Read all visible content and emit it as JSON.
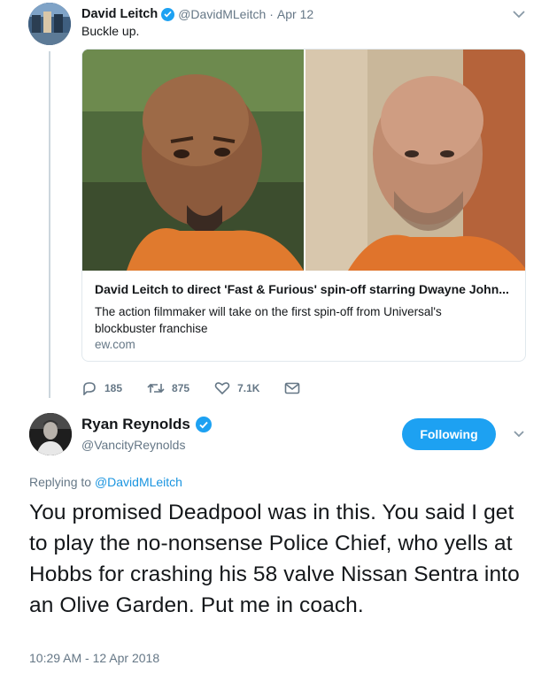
{
  "quoted_tweet": {
    "author_name": "David Leitch",
    "handle": "@DavidMLeitch",
    "date": "Apr 12",
    "text": "Buckle up.",
    "card": {
      "title": "David Leitch to direct 'Fast & Furious' spin-off starring Dwayne John...",
      "description": "The action filmmaker will take on the first spin-off from Universal's blockbuster franchise",
      "domain": "ew.com"
    },
    "actions": {
      "replies": "185",
      "retweets": "875",
      "likes": "7.1K"
    }
  },
  "reply_tweet": {
    "author_name": "Ryan Reynolds",
    "handle": "@VancityReynolds",
    "follow_label": "Following",
    "replying_prefix": "Replying to",
    "replying_to": "@DavidMLeitch",
    "text": "You promised Deadpool was in this. You said I get to play the no-nonsense Police Chief, who yells at Hobbs for crashing his 58 valve Nissan Sentra into an Olive Garden. Put me in coach.",
    "timestamp": "10:29 AM - 12 Apr 2018"
  },
  "colors": {
    "accent": "#1da1f2",
    "link": "#1b95e0",
    "secondary_text": "#657786",
    "border": "#e1e8ed"
  },
  "icons": [
    "verified-badge-icon",
    "chevron-down-icon",
    "reply-icon",
    "retweet-icon",
    "like-icon",
    "direct-message-icon"
  ]
}
